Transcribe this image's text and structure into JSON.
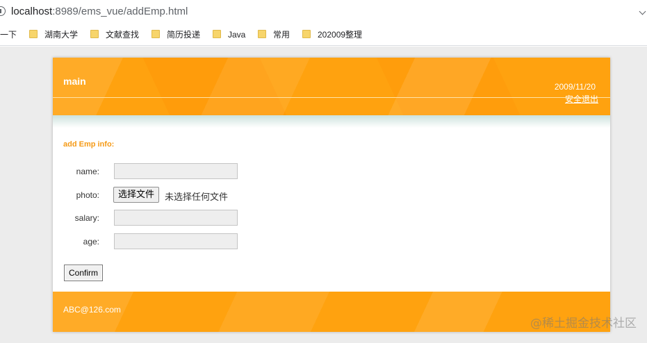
{
  "browser": {
    "url_host": "localhost",
    "url_path": ":8989/ems_vue/addEmp.html",
    "bookmarks_partial": "一下",
    "bookmarks": [
      "湖南大学",
      "文献查找",
      "简历投递",
      "Java",
      "常用",
      "202009整理"
    ]
  },
  "header": {
    "brand": "main",
    "date": "2009/11/20",
    "logout": "安全退出"
  },
  "form": {
    "title": "add Emp info:",
    "name_label": "name:",
    "photo_label": "photo:",
    "file_button": "选择文件",
    "file_status": "未选择任何文件",
    "salary_label": "salary:",
    "age_label": "age:",
    "name_value": "",
    "salary_value": "",
    "age_value": "",
    "confirm": "Confirm"
  },
  "footer": {
    "email": "ABC@126.com"
  },
  "watermark": "@稀土掘金技术社区",
  "colors": {
    "accent": "#ffa20f",
    "title": "#f59a16"
  }
}
